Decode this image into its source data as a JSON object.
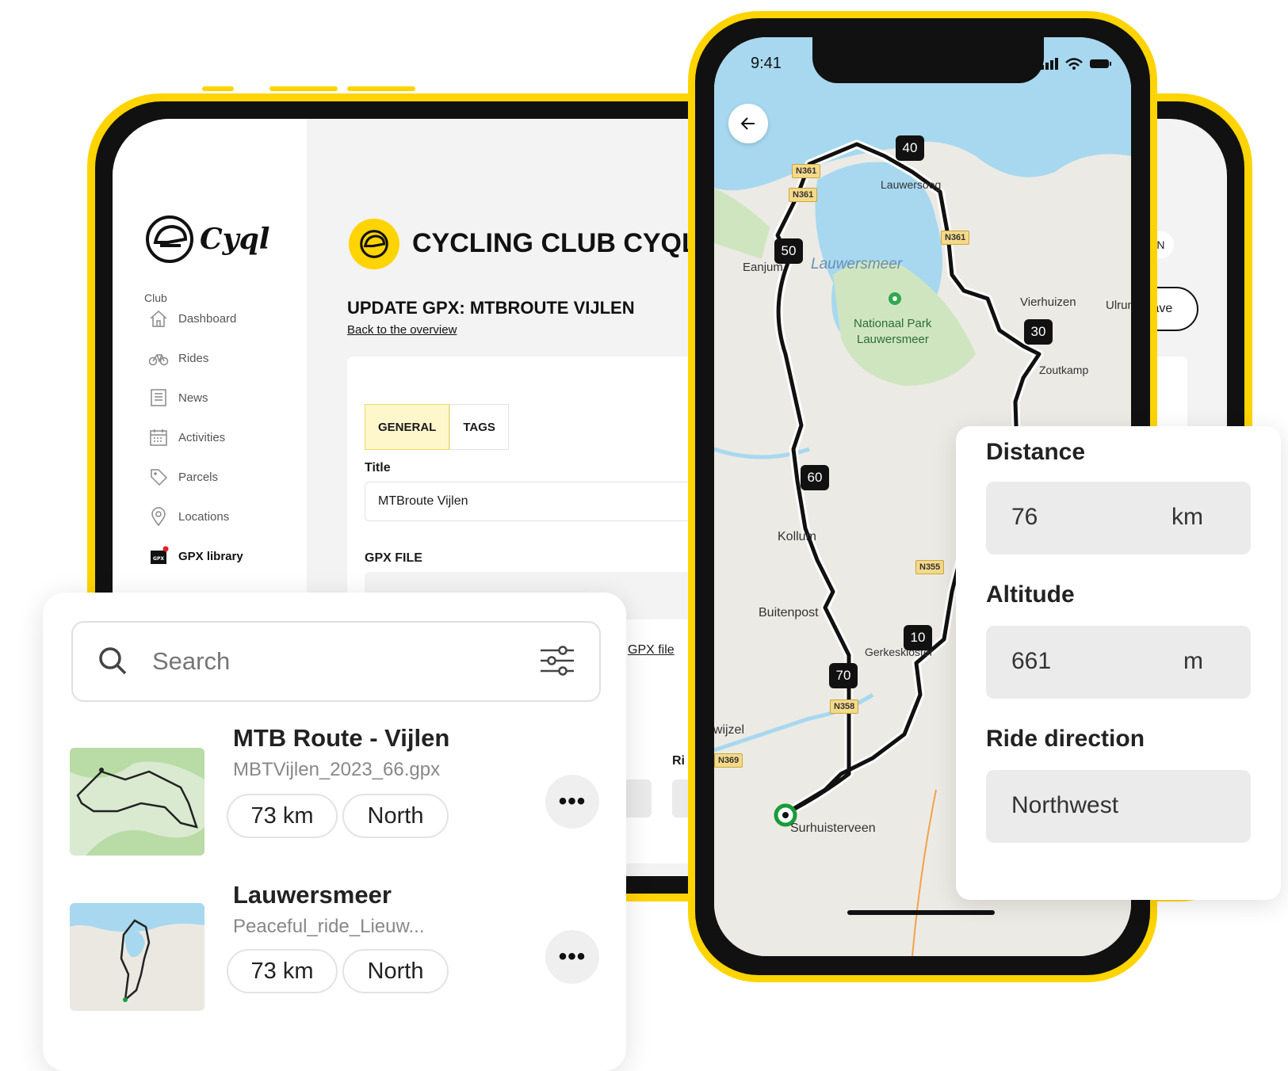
{
  "club": {
    "logo_text": "Cyql",
    "name": "CYCLING CLUB CYQL"
  },
  "sidebar": {
    "section_label": "Club",
    "items": [
      {
        "label": "Dashboard",
        "icon": "home-icon"
      },
      {
        "label": "Rides",
        "icon": "bike-icon"
      },
      {
        "label": "News",
        "icon": "news-icon"
      },
      {
        "label": "Activities",
        "icon": "calendar-icon"
      },
      {
        "label": "Parcels",
        "icon": "tag-icon"
      },
      {
        "label": "Locations",
        "icon": "pin-icon"
      },
      {
        "label": "GPX library",
        "icon": "gpx-icon",
        "active": true
      }
    ]
  },
  "page": {
    "title": "UPDATE GPX: MTBROUTE VIJLEN",
    "back_link": "Back to the overview",
    "language": "EN",
    "save_label": "Save"
  },
  "form": {
    "tabs": [
      "GENERAL",
      "TAGS"
    ],
    "title_label": "Title",
    "title_value": "MTBroute Vijlen",
    "gpx_label": "GPX FILE",
    "gpx_link": "GPX file",
    "ride_label_partial": "Ri"
  },
  "phone": {
    "time": "9:41",
    "map": {
      "markers": [
        "40",
        "50",
        "30",
        "60",
        "10",
        "70"
      ],
      "places": [
        "Lauwersoog",
        "Lauwersmeer",
        "Nationaal Park",
        "Lauwersmeer",
        "Vierhuizen",
        "Ulrum",
        "Zoutkamp",
        "Eanjum",
        "Kollum",
        "Buitenpost",
        "Gerkeskloster",
        "Surhuisterveen",
        "Twijzel"
      ],
      "roads": [
        "N361",
        "N361",
        "N361",
        "N355",
        "N358",
        "N369"
      ]
    }
  },
  "stats": {
    "distance_label": "Distance",
    "distance_value": "76",
    "distance_unit": "km",
    "altitude_label": "Altitude",
    "altitude_value": "661",
    "altitude_unit": "m",
    "direction_label": "Ride direction",
    "direction_value": "Northwest"
  },
  "library": {
    "search_placeholder": "Search",
    "routes": [
      {
        "title": "MTB Route - Vijlen",
        "file": "MBTVijlen_2023_66.gpx",
        "distance": "73 km",
        "direction": "North"
      },
      {
        "title": "Lauwersmeer",
        "file": "Peaceful_ride_Lieuw...",
        "distance": "73 km",
        "direction": "North"
      }
    ],
    "more_label": "•••"
  },
  "colors": {
    "brand_yellow": "#ffd400",
    "device_black": "#111111",
    "water": "#a7d8f0",
    "land": "#eceae4",
    "park": "#cfe5c0"
  }
}
